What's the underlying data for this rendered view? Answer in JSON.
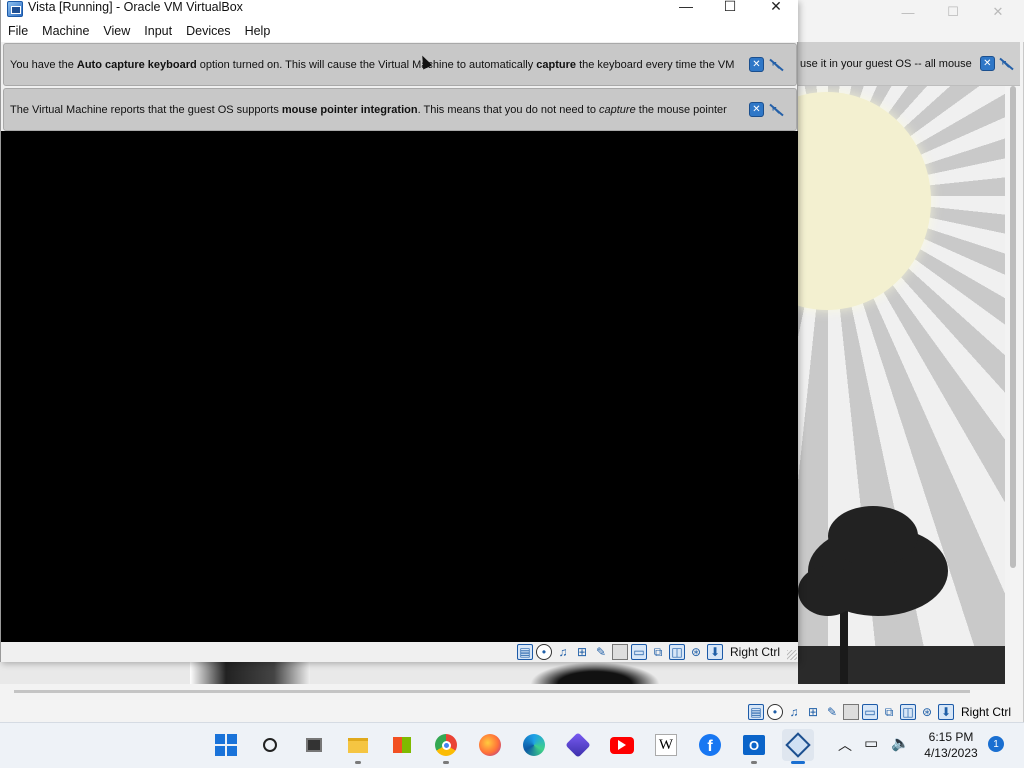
{
  "fg_window": {
    "title": "Vista [Running] - Oracle VM VirtualBox",
    "menu": [
      "File",
      "Machine",
      "View",
      "Input",
      "Devices",
      "Help"
    ],
    "caption_buttons": {
      "minimize": "—",
      "maximize": "☐",
      "close": "✕"
    },
    "notice_keyboard": {
      "pre": "You have the ",
      "bold1": "Auto capture keyboard",
      "mid": " option turned on. This will cause the Virtual Machine to automatically ",
      "bold2": "capture",
      "post": " the keyboard every time the VM"
    },
    "notice_mouse": {
      "pre": "The Virtual Machine reports that the guest OS supports ",
      "bold1": "mouse pointer integration",
      "mid": ". This means that you do not need to ",
      "italic1": "capture",
      "post": " the mouse pointer"
    },
    "status_icons": [
      "hard-disk-icon",
      "optical-drive-icon",
      "audio-icon",
      "network-icon",
      "usb-icon",
      "shared-folder-icon",
      "display-icon",
      "video-capture-icon",
      "recording-icon",
      "mouse-integration-icon",
      "keyboard-capture-icon"
    ],
    "host_key": "Right Ctrl"
  },
  "bg_window": {
    "notice_fragment": "use it in your guest OS -- all mouse",
    "host_key": "Right Ctrl"
  },
  "taskbar": {
    "apps": [
      "start-icon",
      "search-icon",
      "task-view-icon",
      "file-explorer-icon",
      "microsoft-store-icon",
      "chrome-icon",
      "firefox-icon",
      "edge-icon",
      "clipchamp-icon",
      "youtube-icon",
      "wikipedia-icon",
      "facebook-icon",
      "outlook-icon",
      "virtualbox-icon"
    ],
    "wikipedia_letter": "W",
    "facebook_letter": "f",
    "outlook_letter": "O",
    "clock_time": "6:15 PM",
    "clock_date": "4/13/2023",
    "notification_count": "1"
  }
}
